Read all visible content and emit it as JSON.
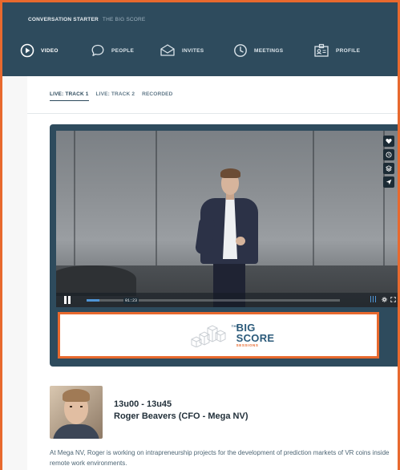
{
  "header": {
    "section": "CONVERSATION STARTER",
    "event": "THE BIG SCORE"
  },
  "nav": {
    "items": [
      {
        "label": "VIDEO",
        "icon": "play-circle-icon"
      },
      {
        "label": "PEOPLE",
        "icon": "chat-bubble-icon"
      },
      {
        "label": "INVITES",
        "icon": "envelope-icon"
      },
      {
        "label": "MEETINGS",
        "icon": "clock-icon"
      },
      {
        "label": "PROFILE",
        "icon": "id-card-icon"
      }
    ]
  },
  "tabs": [
    {
      "label": "LIVE: TRACK 1"
    },
    {
      "label": "LIVE: TRACK 2"
    },
    {
      "label": "RECORDED"
    }
  ],
  "player": {
    "time": "01:23",
    "progress": 0.05,
    "side_icons": [
      "heart-icon",
      "clock-icon",
      "layers-icon",
      "send-icon"
    ]
  },
  "sponsor": {
    "the": "THE",
    "big": "BIG",
    "score": "SCORE",
    "sessions": "SESSIONS"
  },
  "session": {
    "time": "13u00 - 13u45",
    "speaker": "Roger Beavers (CFO - Mega NV)",
    "description": "At Mega NV, Roger is working on intrapreneurship projects for the development of prediction markets of VR coins inside remote work environments."
  },
  "colors": {
    "header_bg": "#2e4b5d",
    "accent": "#e8692e",
    "progress": "#4f95d6",
    "text": "#22303a"
  }
}
